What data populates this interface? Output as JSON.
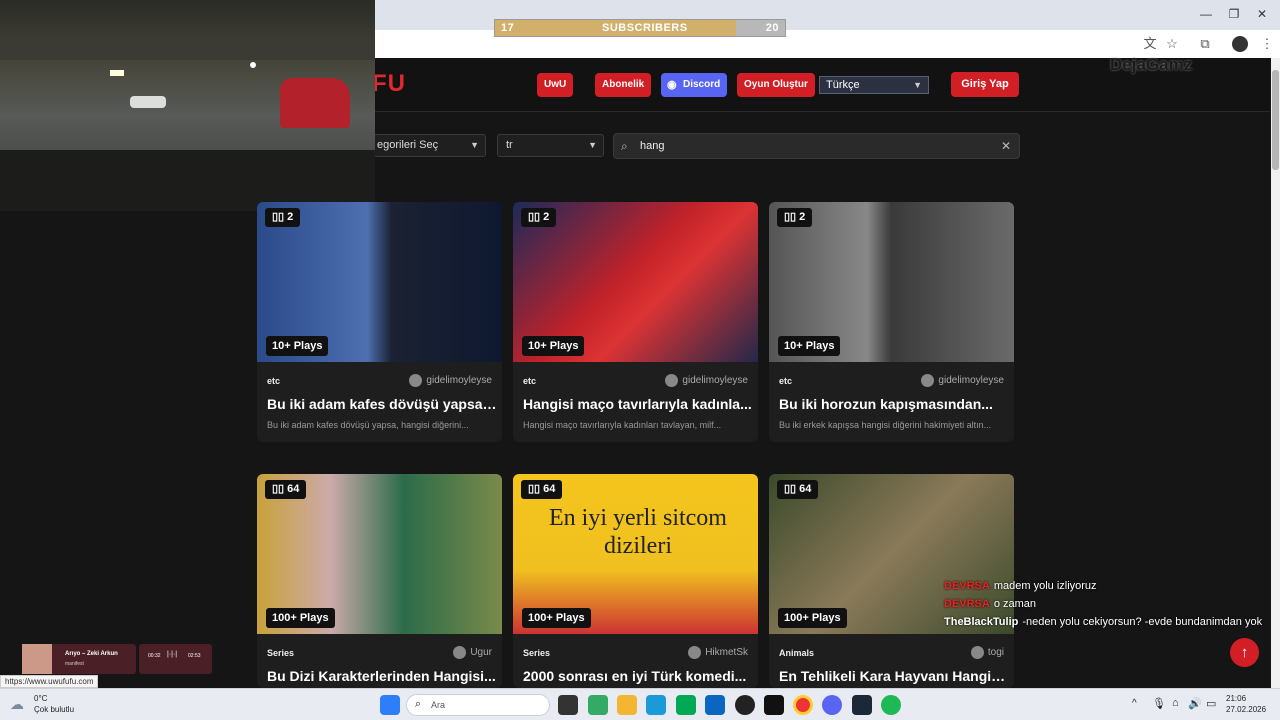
{
  "overlay": {
    "subscribers": {
      "label": "SUBSCRIBERS",
      "current": "17",
      "goal": "20",
      "progress": 0.83
    }
  },
  "site": {
    "logo": "FU",
    "nav": [
      "UwU",
      "Abonelik",
      "Discord",
      "Oyun Oluştur"
    ],
    "language": "Türkçe",
    "login": "Giriş Yap",
    "watermark": "DejaGamz"
  },
  "filters": {
    "category": "egorileri Seç",
    "locale": "tr",
    "search_value": "hang"
  },
  "cards": [
    {
      "count": "2",
      "plays": "10+ Plays",
      "category": "etc",
      "author": "gidelimoyleyse",
      "title": "Bu iki adam kafes dövüşü yapsa,...",
      "desc": "Bu iki adam kafes dövüşü yapsa, hangisi diğerini..."
    },
    {
      "count": "2",
      "plays": "10+ Plays",
      "category": "etc",
      "author": "gidelimoyleyse",
      "title": "Hangisi maço tavırlarıyla kadınla...",
      "desc": "Hangisi maço tavırlarıyla kadınları tavlayan, milf..."
    },
    {
      "count": "2",
      "plays": "10+ Plays",
      "category": "etc",
      "author": "gidelimoyleyse",
      "title": "Bu iki horozun kapışmasından...",
      "desc": "Bu iki erkek kapışsa hangisi diğerini hakimiyeti altın..."
    },
    {
      "count": "64",
      "plays": "100+ Plays",
      "category": "Series",
      "author": "Ugur",
      "title": "Bu Dizi Karakterlerinden Hangisi...",
      "desc": ""
    },
    {
      "count": "64",
      "plays": "100+ Plays",
      "category": "Series",
      "author": "HikmetSk",
      "title": "2000 sonrası en iyi Türk komedi...",
      "desc": "",
      "thumb_text": "En iyi yerli sitcom dizileri"
    },
    {
      "count": "64",
      "plays": "100+ Plays",
      "category": "Animals",
      "author": "togi",
      "title": "En Tehlikeli Kara Hayvanı Hangis...",
      "desc": ""
    }
  ],
  "chat": [
    {
      "user": "DEVRSA",
      "msg": "madem yolu izliyoruz"
    },
    {
      "user": "DEVRSA",
      "msg": "o zaman"
    },
    {
      "user": "TheBlackTulip",
      "msg": "-neden yolu cekiyorsun? -evde bundanimdan yok"
    }
  ],
  "music": {
    "song": "Arıyo – Zeki Arkun",
    "artist": "manifest",
    "elapsed": "00:32",
    "total": "02:53"
  },
  "status_url": "https://www.uwufufu.com",
  "taskbar": {
    "weather_temp": "0°C",
    "weather_desc": "Çok bulutlu",
    "search_placeholder": "Ara",
    "time": "21:06",
    "date": "27.02.2026"
  },
  "colors": {
    "accent": "#d21f25",
    "discord": "#5865f2",
    "background": "#151515"
  }
}
